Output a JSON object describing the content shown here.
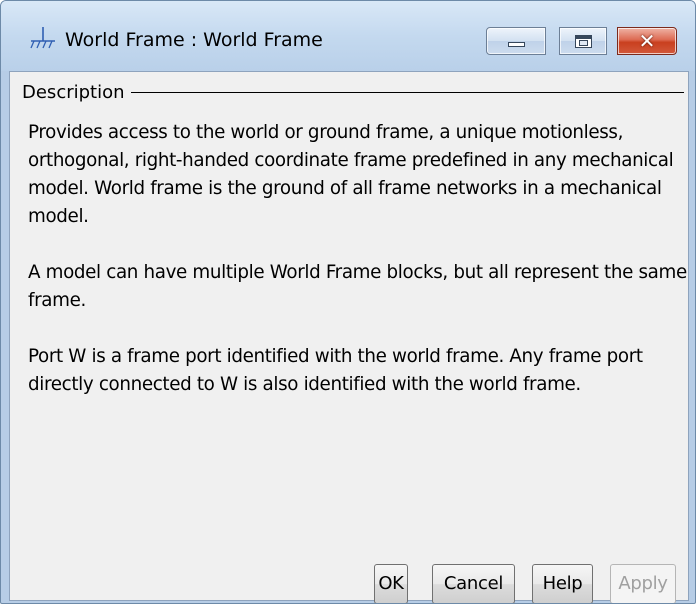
{
  "window": {
    "title": "World Frame : World Frame",
    "icon": "world-frame-ground-icon",
    "caption_buttons": [
      "minimize-icon",
      "maximize-icon",
      "close-icon"
    ],
    "close_glyph": "✕"
  },
  "description": {
    "heading": "Description",
    "paragraphs": [
      "Provides access to the world or ground frame, a unique motionless, orthogonal, right-handed coordinate frame predefined in any mechanical model. World frame is the ground of all frame networks in a mechanical model.",
      "A model can have multiple World Frame blocks, but all represent the same frame.",
      "Port W is a frame port identified with the world frame. Any frame port directly connected to W is also identified with the world frame."
    ]
  },
  "buttons": {
    "ok": "OK",
    "cancel": "Cancel",
    "help": "Help",
    "apply": "Apply",
    "apply_enabled": false
  },
  "colors": {
    "titlebar": "#c4d9ef",
    "client_bg": "#f0f0f0",
    "close_button": "#c9401f",
    "disabled_text": "#a0a0a0"
  }
}
